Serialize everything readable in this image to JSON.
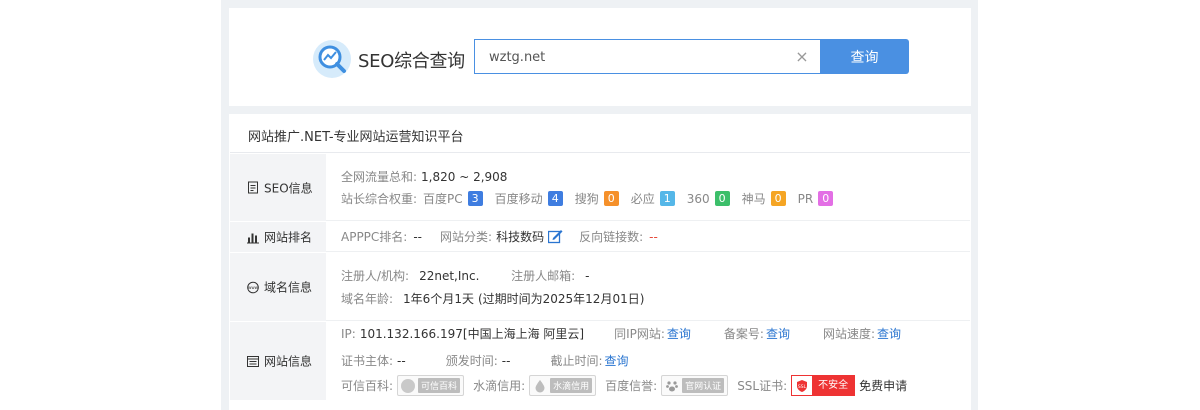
{
  "search": {
    "title": "SEO综合查询",
    "query": "wztg.net",
    "button_label": "查询"
  },
  "site": {
    "title": "网站推广.NET-专业网站运营知识平台"
  },
  "seo": {
    "section_label": "SEO信息",
    "traffic_label": "全网流量总和:",
    "traffic_value": "1,820 ~ 2,908",
    "weight_label": "站长综合权重:",
    "weights": [
      {
        "label": "百度PC",
        "value": "3",
        "color": "#3f7de0"
      },
      {
        "label": "百度移动",
        "value": "4",
        "color": "#3f7de0"
      },
      {
        "label": "搜狗",
        "value": "0",
        "color": "#f5902a"
      },
      {
        "label": "必应",
        "value": "1",
        "color": "#55b7e8"
      },
      {
        "label": "360",
        "value": "0",
        "color": "#3cbf6a"
      },
      {
        "label": "神马",
        "value": "0",
        "color": "#f5a524"
      },
      {
        "label": "PR",
        "value": "0",
        "color": "#e36fe5"
      }
    ]
  },
  "ranking": {
    "section_label": "网站排名",
    "apppc_label": "APPPC排名:",
    "apppc_value": "--",
    "category_label": "网站分类:",
    "category_value": "科技数码",
    "backlinks_label": "反向链接数:",
    "backlinks_value": "--"
  },
  "domain": {
    "section_label": "域名信息",
    "registrant_label": "注册人/机构:",
    "registrant_value": "22net,Inc.",
    "email_label": "注册人邮箱:",
    "email_value": "-",
    "age_label": "域名年龄:",
    "age_value": "1年6个月1天",
    "expiry_text": "(过期时间为2025年12月01日)"
  },
  "website": {
    "section_label": "网站信息",
    "ip_label": "IP:",
    "ip_value": "101.132.166.197[中国上海上海 阿里云]",
    "same_ip_label": "同IP网站:",
    "same_ip_link": "查询",
    "icp_label": "备案号:",
    "icp_link": "查询",
    "speed_label": "网站速度:",
    "speed_link": "查询",
    "cert_subject_label": "证书主体:",
    "cert_subject_value": "--",
    "issue_label": "颁发时间:",
    "issue_value": "--",
    "expire_label": "截止时间:",
    "expire_link": "查询",
    "trust_label": "可信百科:",
    "trust_seal": "可信百科",
    "shuidi_label": "水滴信用:",
    "shuidi_seal": "水滴信用",
    "baidu_label": "百度信誉:",
    "baidu_seal": "官网认证",
    "ssl_label": "SSL证书:",
    "ssl_status": "不安全",
    "ssl_apply": "免费申请"
  }
}
